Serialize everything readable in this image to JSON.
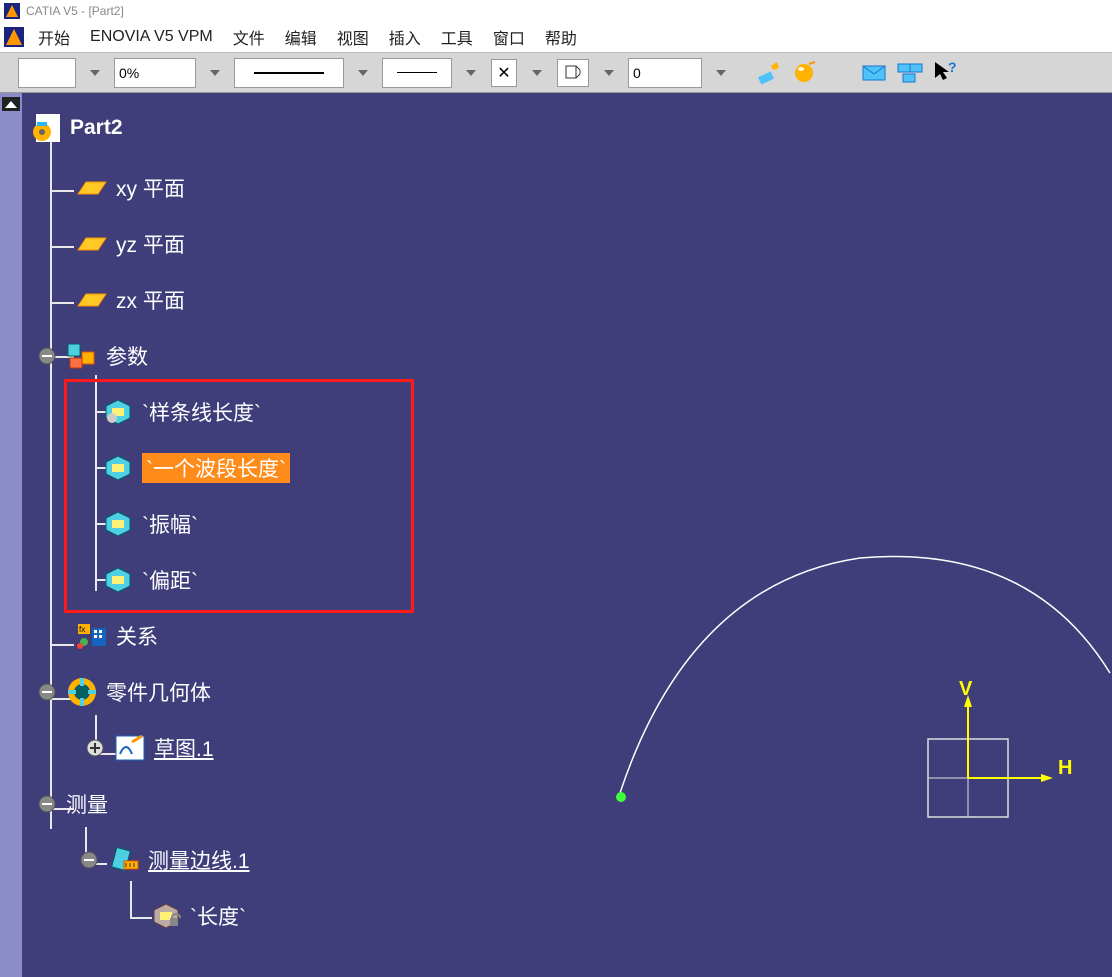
{
  "titlebar": {
    "text": "CATIA V5 - [Part2]"
  },
  "menu": {
    "start": "开始",
    "enovia": "ENOVIA V5 VPM",
    "file": "文件",
    "edit": "编辑",
    "view": "视图",
    "insert": "插入",
    "tools": "工具",
    "window": "窗口",
    "help": "帮助"
  },
  "toolbar": {
    "percent": "0%",
    "cross": "✕",
    "value": "0"
  },
  "tree": {
    "root": "Part2",
    "plane_xy": "xy 平面",
    "plane_yz": "yz 平面",
    "plane_zx": "zx 平面",
    "params": "参数",
    "param_spline": "`样条线长度`",
    "param_wave": "`一个波段长度`",
    "param_amp": "`振幅`",
    "param_offset": "`偏距`",
    "relations": "关系",
    "partbody": "零件几何体",
    "sketch1": "草图.1",
    "measure": "测量",
    "measure_edge": "测量边线.1",
    "length": "`长度`"
  },
  "viewport": {
    "axis_v": "V",
    "axis_h": "H"
  }
}
